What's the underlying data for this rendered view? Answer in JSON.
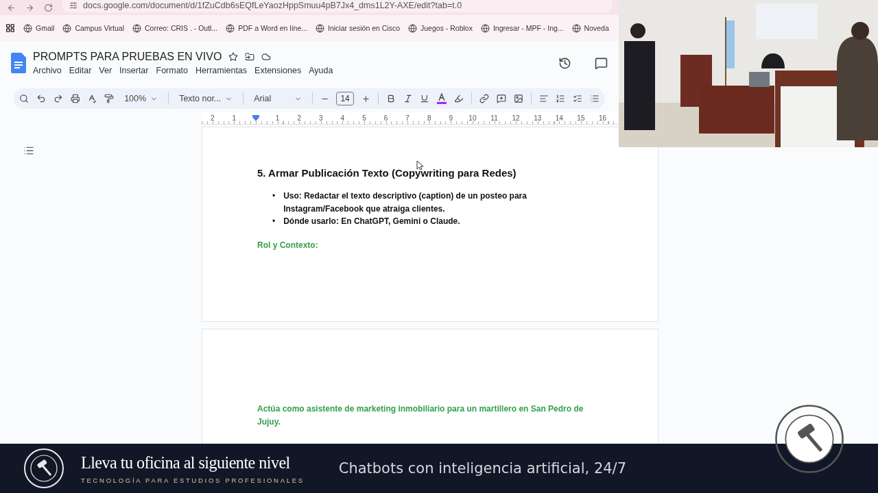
{
  "browser": {
    "url": "docs.google.com/document/d/1fZuCdb6sEQfLeYaozHppSmuu4pB7Jx4_dms1L2Y-AXE/edit?tab=t.0",
    "bookmarks": [
      {
        "label": "Gmail"
      },
      {
        "label": "Campus Virtual"
      },
      {
        "label": "Correo: CRIS . - Outl..."
      },
      {
        "label": "PDF a Word en líne..."
      },
      {
        "label": "Iniciar sesión en Cisco"
      },
      {
        "label": "Juegos - Roblox"
      },
      {
        "label": "Ingresar - MPF - Ing..."
      },
      {
        "label": "Noveda"
      }
    ]
  },
  "document": {
    "title": "PROMPTS PARA PRUEBAS EN VIVO",
    "menu": [
      "Archivo",
      "Editar",
      "Ver",
      "Insertar",
      "Formato",
      "Herramientas",
      "Extensiones",
      "Ayuda"
    ]
  },
  "toolbar": {
    "zoom": "100%",
    "style": "Texto nor...",
    "font": "Arial",
    "font_size": "14"
  },
  "ruler": [
    {
      "kind": "number",
      "label": "2"
    },
    {
      "kind": "number",
      "label": "1"
    },
    {
      "kind": "marker"
    },
    {
      "kind": "number",
      "label": "1"
    },
    {
      "kind": "number",
      "label": "2"
    },
    {
      "kind": "number",
      "label": "3"
    },
    {
      "kind": "number",
      "label": "4"
    },
    {
      "kind": "number",
      "label": "5"
    },
    {
      "kind": "number",
      "label": "6"
    },
    {
      "kind": "number",
      "label": "7"
    },
    {
      "kind": "number",
      "label": "8"
    },
    {
      "kind": "number",
      "label": "9"
    },
    {
      "kind": "number",
      "label": "10"
    },
    {
      "kind": "number",
      "label": "11"
    },
    {
      "kind": "number",
      "label": "12"
    },
    {
      "kind": "number",
      "label": "13"
    },
    {
      "kind": "number",
      "label": "14"
    },
    {
      "kind": "number",
      "label": "15"
    },
    {
      "kind": "number",
      "label": "16"
    }
  ],
  "page_1": {
    "heading": "5. Armar Publicación Texto (Copywriting para Redes)",
    "bullets": [
      {
        "marker": "•",
        "text": "Uso: Redactar el texto descriptivo (caption) de un posteo para Instagram/Facebook que atraiga clientes."
      },
      {
        "marker": "•",
        "text": "Dónde usarlo: En ChatGPT, Gemini o Claude."
      }
    ],
    "section_label": "Rol y Contexto:"
  },
  "page_2": {
    "paragraph": "Actúa como asistente de marketing inmobiliario para un martillero en San Pedro de Jujuy."
  },
  "banner": {
    "title": "Lleva tu oficina al siguiente nivel",
    "subtitle": "TECNOLOGÍA PARA ESTUDIOS PROFESIONALES",
    "tagline": "Chatbots con inteligencia artificial, 24/7"
  }
}
